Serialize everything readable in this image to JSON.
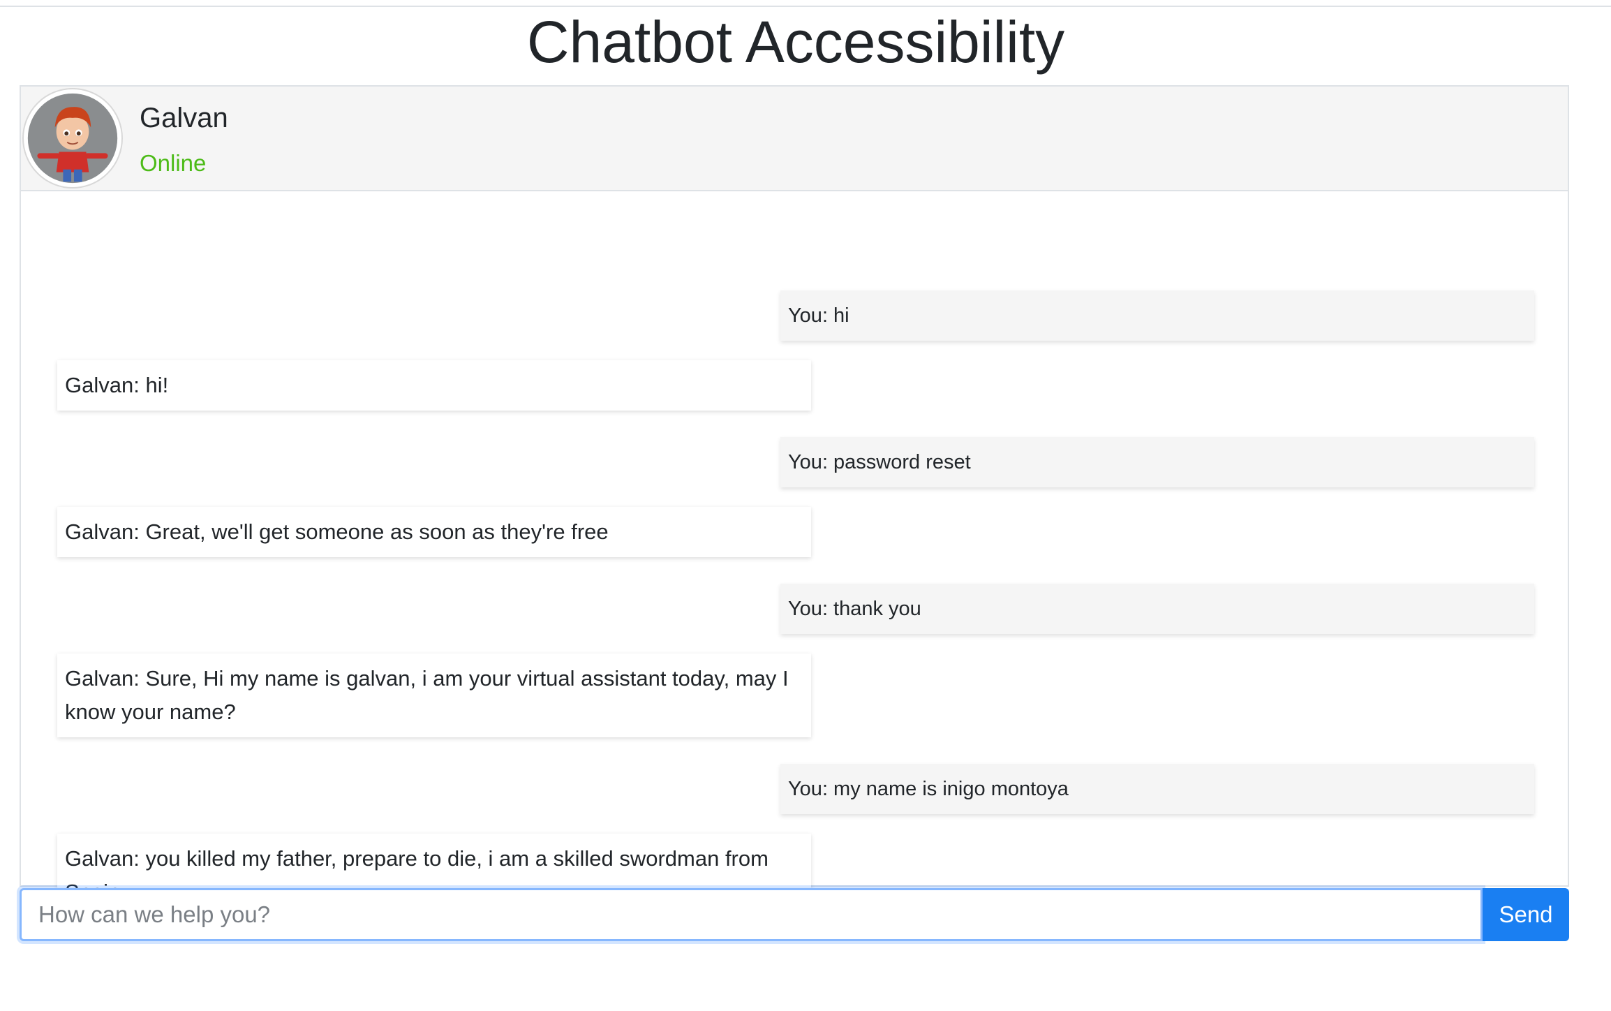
{
  "page": {
    "title": "Chatbot Accessibility"
  },
  "header": {
    "bot_name": "Galvan",
    "status": "Online",
    "avatar_icon": "cartoon-boy-avatar",
    "status_color": "#4cbb17"
  },
  "messages": [
    {
      "sender": "user",
      "text": "You: hi"
    },
    {
      "sender": "bot",
      "text": "Galvan: hi!"
    },
    {
      "sender": "user",
      "text": "You: password reset"
    },
    {
      "sender": "bot",
      "text": "Galvan: Great, we'll get someone as soon as they're free"
    },
    {
      "sender": "user",
      "text": "You: thank you"
    },
    {
      "sender": "bot",
      "text": "Galvan: Sure, Hi my name is galvan, i am your virtual assistant today, may I know your name?"
    },
    {
      "sender": "user",
      "text": "You: my name is inigo montoya"
    },
    {
      "sender": "bot",
      "text": "Galvan: you killed my father, prepare to die, i am a skilled swordman from Spain"
    }
  ],
  "composer": {
    "value": "",
    "placeholder": "How can we help you?",
    "send_label": "Send",
    "send_color": "#1a7ff2"
  }
}
